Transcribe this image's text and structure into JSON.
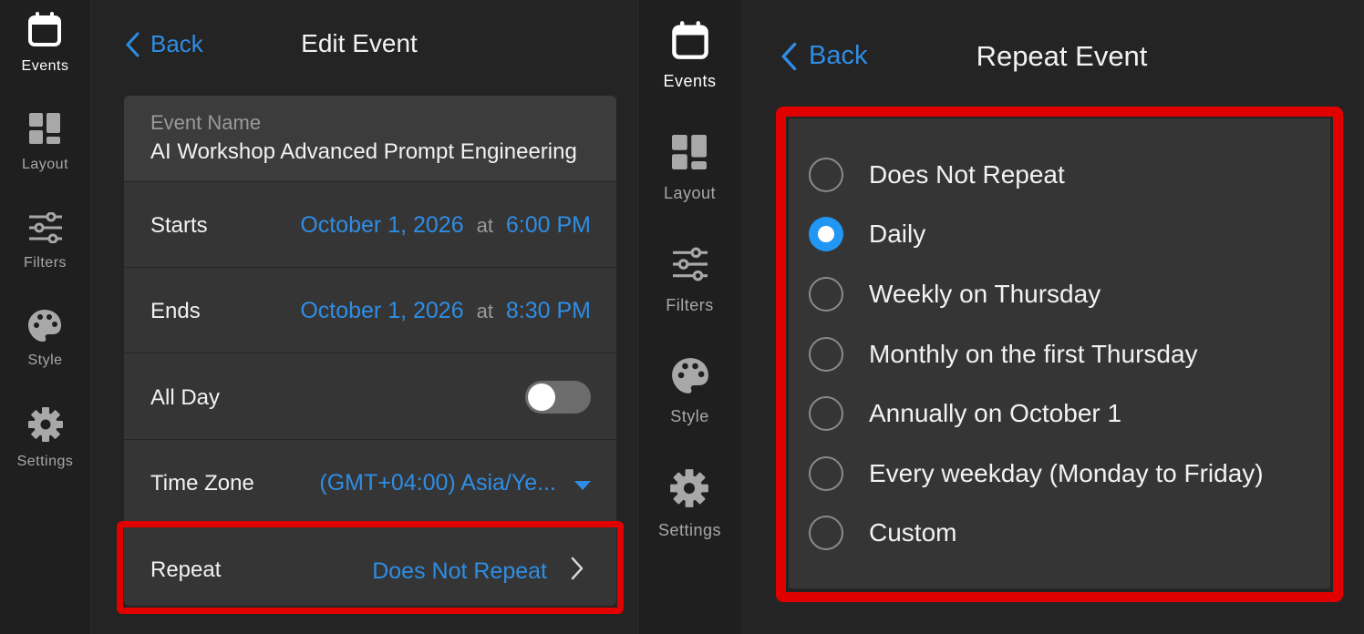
{
  "left_sidebar": {
    "items": [
      {
        "label": "Events",
        "icon": "calendar-icon",
        "active": true
      },
      {
        "label": "Layout",
        "icon": "layout-icon",
        "active": false
      },
      {
        "label": "Filters",
        "icon": "sliders-icon",
        "active": false
      },
      {
        "label": "Style",
        "icon": "palette-icon",
        "active": false
      },
      {
        "label": "Settings",
        "icon": "gear-icon",
        "active": false
      }
    ]
  },
  "edit_event": {
    "back_label": "Back",
    "title": "Edit Event",
    "event_name_label": "Event Name",
    "event_name_value": "AI Workshop Advanced Prompt Engineering",
    "starts": {
      "label": "Starts",
      "date": "October 1, 2026",
      "at": "at",
      "time": "6:00 PM"
    },
    "ends": {
      "label": "Ends",
      "date": "October 1, 2026",
      "at": "at",
      "time": "8:30 PM"
    },
    "all_day": {
      "label": "All Day",
      "on": false
    },
    "time_zone": {
      "label": "Time Zone",
      "value": "(GMT+04:00) Asia/Ye..."
    },
    "repeat": {
      "label": "Repeat",
      "value": "Does Not Repeat"
    }
  },
  "right_sidebar": {
    "items": [
      {
        "label": "Events",
        "icon": "calendar-icon",
        "active": true
      },
      {
        "label": "Layout",
        "icon": "layout-icon",
        "active": false
      },
      {
        "label": "Filters",
        "icon": "sliders-icon",
        "active": false
      },
      {
        "label": "Style",
        "icon": "palette-icon",
        "active": false
      },
      {
        "label": "Settings",
        "icon": "gear-icon",
        "active": false
      }
    ]
  },
  "repeat_event": {
    "back_label": "Back",
    "title": "Repeat Event",
    "selected": "Daily",
    "options": [
      {
        "label": "Does Not Repeat",
        "checked": false
      },
      {
        "label": "Daily",
        "checked": true
      },
      {
        "label": "Weekly on Thursday",
        "checked": false
      },
      {
        "label": "Monthly on the first Thursday",
        "checked": false
      },
      {
        "label": "Annually on October 1",
        "checked": false
      },
      {
        "label": "Every weekday (Monday to Friday)",
        "checked": false
      },
      {
        "label": "Custom",
        "checked": false
      }
    ]
  },
  "colors": {
    "accent": "#2f8de4",
    "highlight": "#e00000",
    "radio_selected": "#2196f3"
  }
}
